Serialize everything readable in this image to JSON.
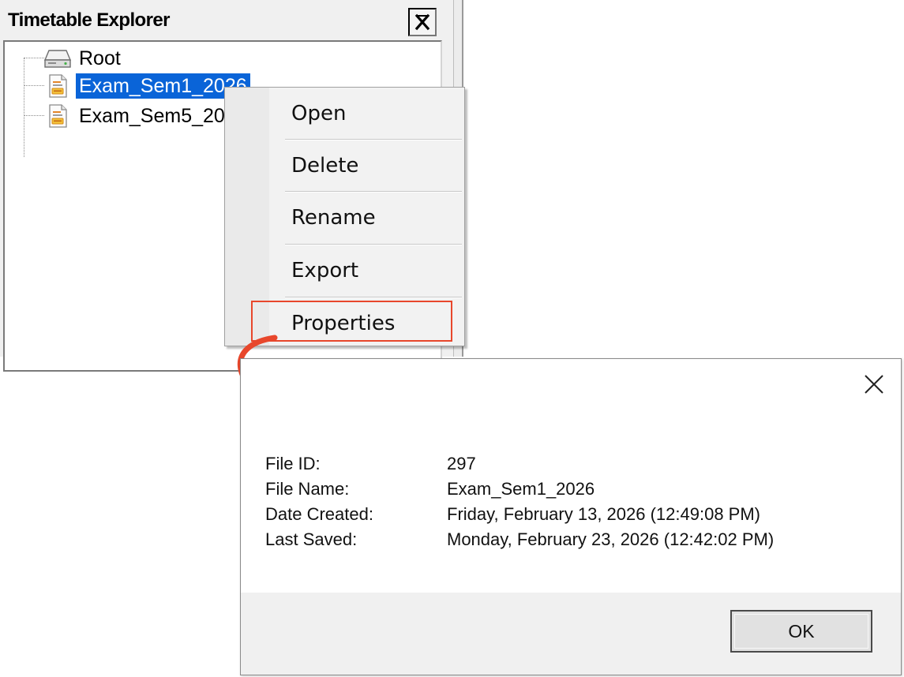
{
  "explorer": {
    "title": "Timetable Explorer",
    "close_icon": "pin-close-icon",
    "tree": [
      {
        "label": "Root",
        "icon": "drive-icon",
        "selected": false
      },
      {
        "label": "Exam_Sem1_2026",
        "icon": "timetable-file-icon",
        "selected": true
      },
      {
        "label": "Exam_Sem5_20",
        "icon": "timetable-file-icon",
        "selected": false
      }
    ]
  },
  "context_menu": {
    "items": [
      {
        "label": "Open"
      },
      {
        "label": "Delete"
      },
      {
        "label": "Rename"
      },
      {
        "label": "Export"
      },
      {
        "label": "Properties",
        "highlighted": true
      }
    ],
    "highlight_color": "#e8472c"
  },
  "properties_dialog": {
    "close_icon": "close-x-icon",
    "fields": [
      {
        "label": "File ID:",
        "value": "297"
      },
      {
        "label": "File Name:",
        "value": "Exam_Sem1_2026"
      },
      {
        "label": "Date Created:",
        "value": "Friday, February 13, 2026 (12:49:08 PM)"
      },
      {
        "label": "Last Saved:",
        "value": "Monday, February 23, 2026 (12:42:02 PM)"
      }
    ],
    "ok_label": "OK"
  },
  "colors": {
    "selection": "#0a64d8",
    "annotation_arrow": "#e8472c"
  }
}
